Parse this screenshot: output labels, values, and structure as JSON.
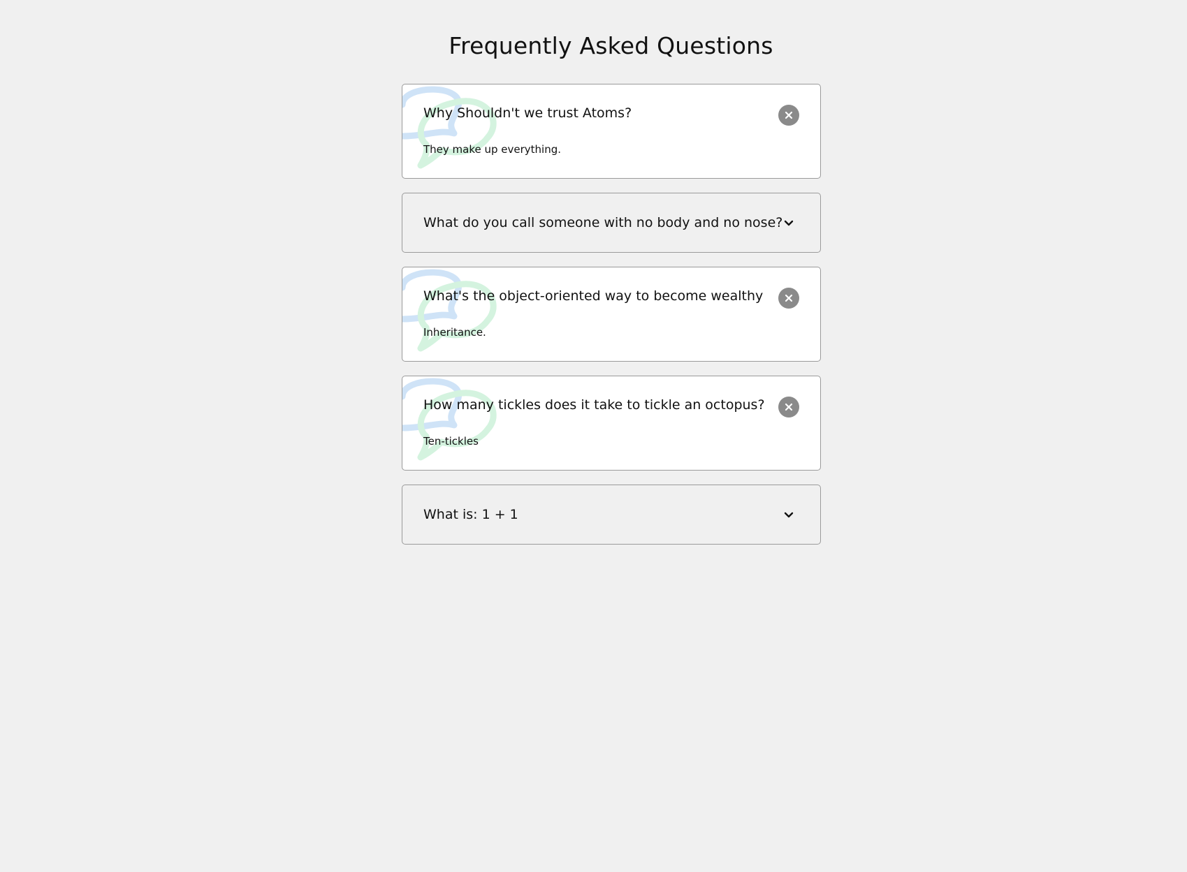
{
  "header": {
    "title": "Frequently Asked Questions"
  },
  "faqs": [
    {
      "question": "Why Shouldn't we trust Atoms?",
      "answer": "They make up everything.",
      "state": "expanded"
    },
    {
      "question": "What do you call someone with no body and no nose?",
      "answer": "",
      "state": "collapsed"
    },
    {
      "question": "What's the object-oriented way to become wealthy",
      "answer": "Inheritance.",
      "state": "expanded"
    },
    {
      "question": "How many tickles does it take to tickle an octopus?",
      "answer": "Ten-tickles",
      "state": "expanded"
    },
    {
      "question": "What is: 1 + 1",
      "answer": "",
      "state": "collapsed"
    }
  ],
  "icons": {
    "expanded_toggle": "close-icon",
    "collapsed_toggle": "chevron-down-icon",
    "decoration": "chat-bubbles-icon"
  },
  "colors": {
    "page_background": "#f0f0f0",
    "card_active_background": "#ffffff",
    "card_border": "#9a9a9a",
    "toggle_circle": "#8a8a8a",
    "bubble_blue": "#cfe3f7",
    "bubble_green": "#d4f3df"
  }
}
